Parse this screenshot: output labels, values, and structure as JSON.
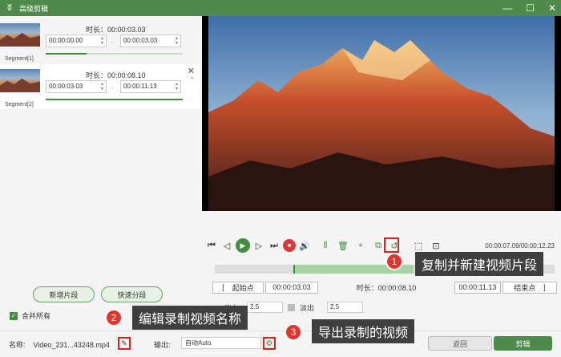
{
  "window": {
    "title": "高级剪辑",
    "logo": "ʬ"
  },
  "segments": [
    {
      "label": "Segment[1]",
      "duration": "时长：00:00:03.03",
      "start": "00:00:00.00",
      "end": "00:00:03.03",
      "progress": 0.3
    },
    {
      "label": "Segment[2]",
      "duration": "时长：00:00:08.10",
      "start": "00:00:03.03",
      "end": "00:00:11.13",
      "progress": 1.0
    }
  ],
  "left": {
    "add_segment": "新增片段",
    "quick_split": "快速分段",
    "merge_all": "合并所有"
  },
  "player": {
    "timecode": "00:00:07.09/00:00:12.23"
  },
  "trim": {
    "start_btn": "起始点",
    "start_val": "00:00:03.03",
    "duration_label": "时长：00:00:08.10",
    "end_val": "00:00:11.13",
    "end_btn": "结束点"
  },
  "fade": {
    "fade_in_label": "淡入",
    "fade_in_val": "2.5",
    "fade_out_label": "淡出",
    "fade_out_val": "2.5"
  },
  "bottom": {
    "name_label": "名称:",
    "name_val": "Video_231...43248.mp4",
    "output_label": "输出:",
    "output_val": "自动Auto",
    "back_btn": "返回",
    "cut_btn": "剪辑"
  },
  "callouts": [
    {
      "num": "1",
      "text": "复制并新建视频片段"
    },
    {
      "num": "2",
      "text": "编辑录制视频名称"
    },
    {
      "num": "3",
      "text": "导出录制的视频"
    }
  ],
  "icons": {
    "minimize": "—",
    "maximize": "☐",
    "close": "✕",
    "prev": "⏮",
    "back": "◁",
    "play": "▶",
    "next": "▷",
    "end": "⏭",
    "stop": "■",
    "volume": "🔊",
    "split": "⫴",
    "delete": "🗑",
    "add": "+",
    "copy": "⧉",
    "undo": "↺",
    "crop": "⬚",
    "snap": "⊡",
    "edit": "✎",
    "gear": "⚙",
    "check": "✓",
    "x": "✕",
    "updown": "⌃",
    "spinup": "▲",
    "spindown": "▼"
  },
  "colors": {
    "brand": "#4e8a4c",
    "accent": "#3f8f3f",
    "callout_badge": "#e0342c"
  }
}
